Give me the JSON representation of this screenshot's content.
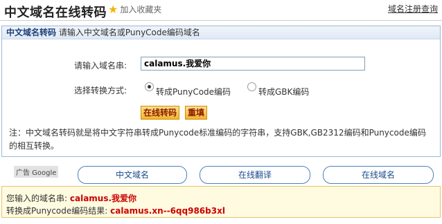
{
  "header": {
    "title": "中文域名在线转码",
    "favorite_label": "加入收藏夹",
    "top_link": "域名注册查询"
  },
  "panel": {
    "head_bold": "中文域名转码",
    "head_text": "请输入中文域名或PunyCode编码域名",
    "input_label": "请输入域名串:",
    "input_value": "calamus.我爱你",
    "mode_label": "选择转换方式:",
    "radio_puny": "转成PunyCode编码",
    "radio_gbk": "转成GBK编码",
    "selected_mode": "PunyCode",
    "btn_convert": "在线转码",
    "btn_reset": "重填",
    "note": "注：中文域名转码就是将中文字符串转成Punycode标准编码的字符串，支持GBK,GB2312编码和Punycode编码的相互转换。"
  },
  "ad_label": "广告 Google",
  "links": [
    "中文域名",
    "在线翻译",
    "在线域名"
  ],
  "result": {
    "input_label": "您输入的域名串:",
    "input_value": "calamus.我爱你",
    "output_label": "转换成Punycode编码结果:",
    "output_value": "calamus.xn--6qq986b3xl"
  },
  "colors": {
    "accent_blue": "#1a4b8c",
    "result_red": "#cc0000",
    "button_gold": "#f3b52b"
  }
}
